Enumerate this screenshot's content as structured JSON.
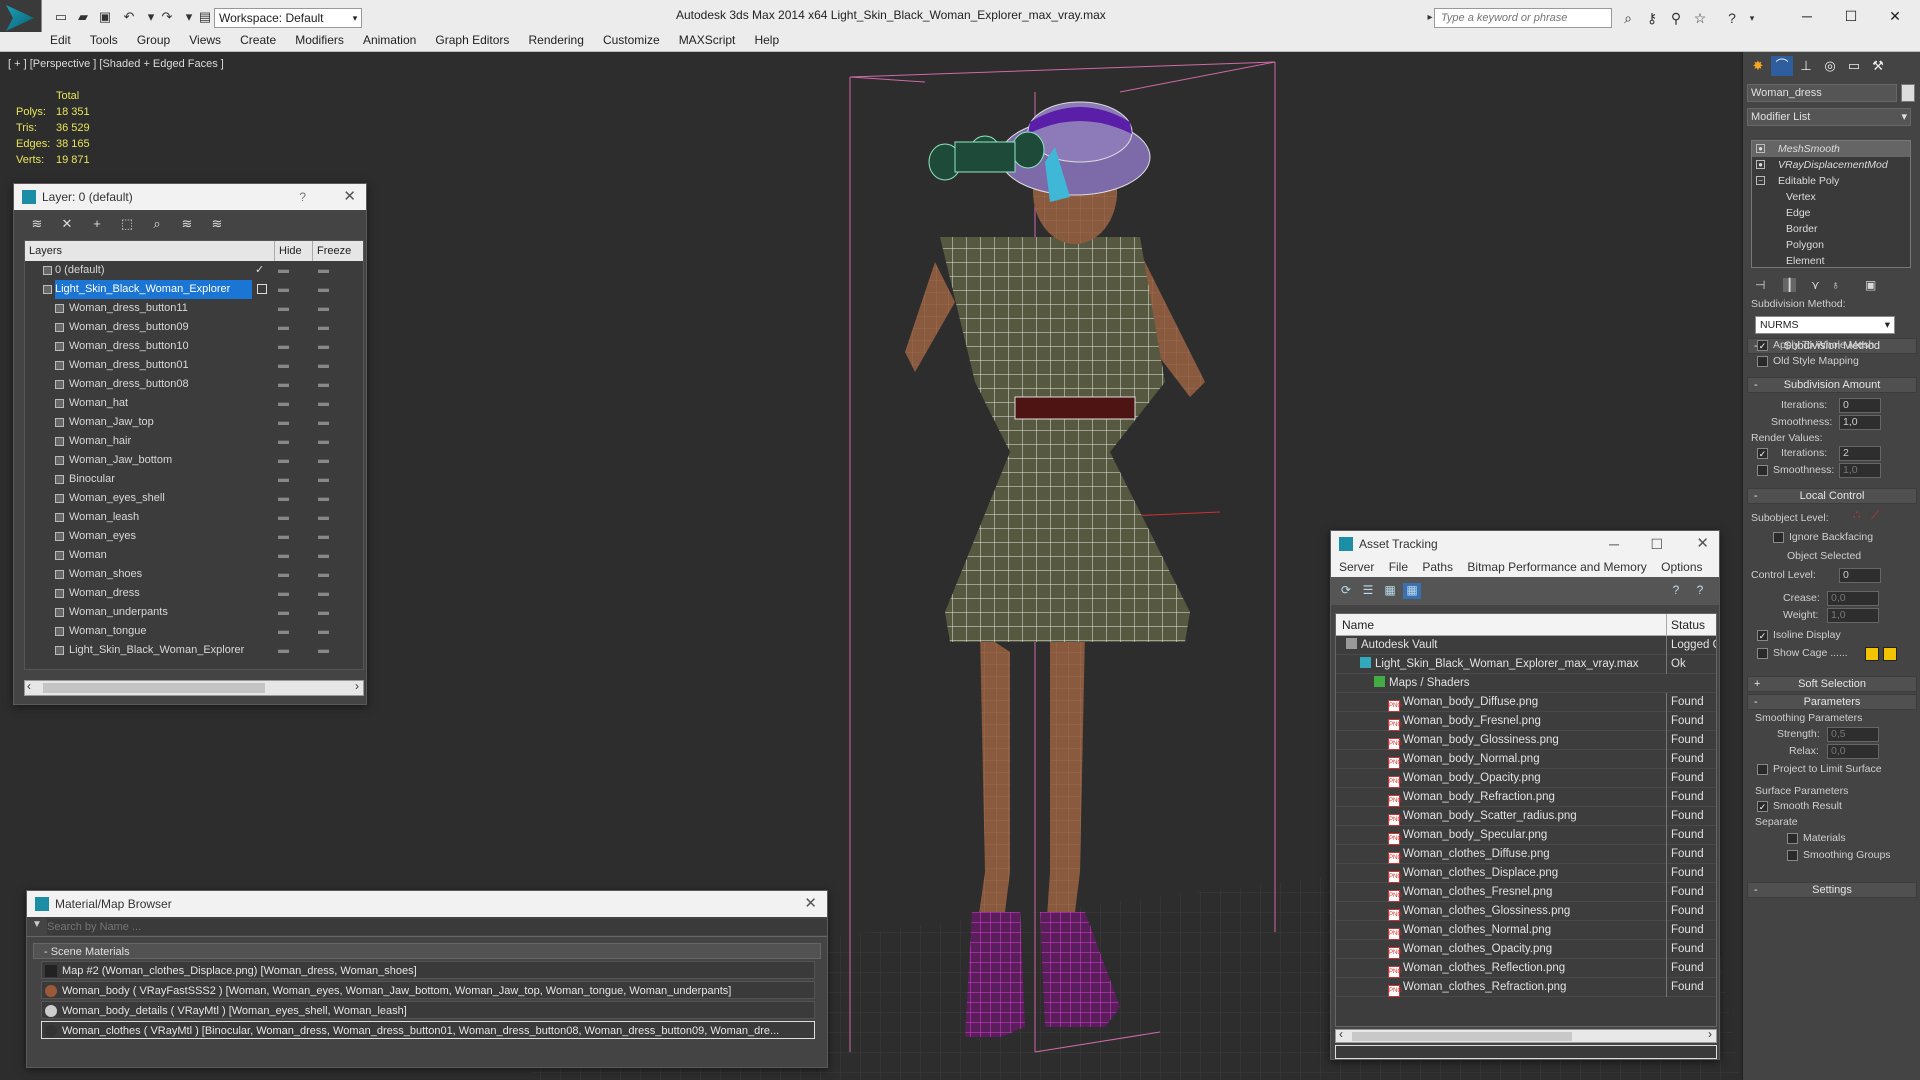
{
  "titlebar": {
    "workspace": "Workspace: Default",
    "app_title": "Autodesk 3ds Max  2014 x64      Light_Skin_Black_Woman_Explorer_max_vray.max",
    "search_placeholder": "Type a keyword or phrase"
  },
  "menu": [
    "Edit",
    "Tools",
    "Group",
    "Views",
    "Create",
    "Modifiers",
    "Animation",
    "Graph Editors",
    "Rendering",
    "Customize",
    "MAXScript",
    "Help"
  ],
  "viewport": {
    "label": "[ + ] [Perspective ] [Shaded + Edged Faces ]",
    "stats_header": "Total",
    "stats": [
      {
        "k": "Polys:",
        "v": "18 351"
      },
      {
        "k": "Tris:",
        "v": "36 529"
      },
      {
        "k": "Edges:",
        "v": "38 165"
      },
      {
        "k": "Verts:",
        "v": "19 871"
      }
    ]
  },
  "layer_panel": {
    "title": "Layer: 0 (default)",
    "help": "?",
    "col_layers": "Layers",
    "col_hide": "Hide",
    "col_freeze": "Freeze",
    "check_mark": "✓",
    "rows": [
      {
        "name": "0 (default)",
        "indent": 1
      },
      {
        "name": "Light_Skin_Black_Woman_Explorer",
        "indent": 1,
        "selected": true
      },
      {
        "name": "Woman_dress_button11",
        "indent": 2
      },
      {
        "name": "Woman_dress_button09",
        "indent": 2
      },
      {
        "name": "Woman_dress_button10",
        "indent": 2
      },
      {
        "name": "Woman_dress_button01",
        "indent": 2
      },
      {
        "name": "Woman_dress_button08",
        "indent": 2
      },
      {
        "name": "Woman_hat",
        "indent": 2
      },
      {
        "name": "Woman_Jaw_top",
        "indent": 2
      },
      {
        "name": "Woman_hair",
        "indent": 2
      },
      {
        "name": "Woman_Jaw_bottom",
        "indent": 2
      },
      {
        "name": "Binocular",
        "indent": 2
      },
      {
        "name": "Woman_eyes_shell",
        "indent": 2
      },
      {
        "name": "Woman_leash",
        "indent": 2
      },
      {
        "name": "Woman_eyes",
        "indent": 2
      },
      {
        "name": "Woman",
        "indent": 2
      },
      {
        "name": "Woman_shoes",
        "indent": 2
      },
      {
        "name": "Woman_dress",
        "indent": 2
      },
      {
        "name": "Woman_underpants",
        "indent": 2
      },
      {
        "name": "Woman_tongue",
        "indent": 2
      },
      {
        "name": "Light_Skin_Black_Woman_Explorer",
        "indent": 2
      }
    ]
  },
  "material_browser": {
    "title": "Material/Map Browser",
    "search_placeholder": "Search by Name ...",
    "section": "- Scene Materials",
    "rows": [
      "Map #2 (Woman_clothes_Displace.png) [Woman_dress, Woman_shoes]",
      "Woman_body  ( VRayFastSSS2 ) [Woman, Woman_eyes, Woman_Jaw_bottom, Woman_Jaw_top, Woman_tongue, Woman_underpants]",
      "Woman_body_details  ( VRayMtl ) [Woman_eyes_shell, Woman_leash]",
      "Woman_clothes  ( VRayMtl ) [Binocular, Woman_dress, Woman_dress_button01, Woman_dress_button08, Woman_dress_button09, Woman_dre..."
    ]
  },
  "asset_tracking": {
    "title": "Asset Tracking",
    "menu": [
      "Server",
      "File",
      "Paths",
      "Bitmap Performance and Memory",
      "Options"
    ],
    "col_name": "Name",
    "col_status": "Status",
    "png_tag": "PNG",
    "rows": [
      {
        "name": "Autodesk Vault",
        "status": "Logged O",
        "indent": 0
      },
      {
        "name": "Light_Skin_Black_Woman_Explorer_max_vray.max",
        "status": "Ok",
        "indent": 1
      },
      {
        "name": "Maps / Shaders",
        "status": "",
        "indent": 2
      },
      {
        "name": "Woman_body_Diffuse.png",
        "status": "Found",
        "indent": 3
      },
      {
        "name": "Woman_body_Fresnel.png",
        "status": "Found",
        "indent": 3
      },
      {
        "name": "Woman_body_Glossiness.png",
        "status": "Found",
        "indent": 3
      },
      {
        "name": "Woman_body_Normal.png",
        "status": "Found",
        "indent": 3
      },
      {
        "name": "Woman_body_Opacity.png",
        "status": "Found",
        "indent": 3
      },
      {
        "name": "Woman_body_Refraction.png",
        "status": "Found",
        "indent": 3
      },
      {
        "name": "Woman_body_Scatter_radius.png",
        "status": "Found",
        "indent": 3
      },
      {
        "name": "Woman_body_Specular.png",
        "status": "Found",
        "indent": 3
      },
      {
        "name": "Woman_clothes_Diffuse.png",
        "status": "Found",
        "indent": 3
      },
      {
        "name": "Woman_clothes_Displace.png",
        "status": "Found",
        "indent": 3
      },
      {
        "name": "Woman_clothes_Fresnel.png",
        "status": "Found",
        "indent": 3
      },
      {
        "name": "Woman_clothes_Glossiness.png",
        "status": "Found",
        "indent": 3
      },
      {
        "name": "Woman_clothes_Normal.png",
        "status": "Found",
        "indent": 3
      },
      {
        "name": "Woman_clothes_Opacity.png",
        "status": "Found",
        "indent": 3
      },
      {
        "name": "Woman_clothes_Reflection.png",
        "status": "Found",
        "indent": 3
      },
      {
        "name": "Woman_clothes_Refraction.png",
        "status": "Found",
        "indent": 3
      }
    ]
  },
  "command_panel": {
    "object_name": "Woman_dress",
    "modifier_list": "Modifier List",
    "stack": [
      {
        "name": "MeshSmooth",
        "italic": true,
        "selected": true
      },
      {
        "name": "VRayDisplacementMod",
        "italic": true
      },
      {
        "name": "Editable Poly"
      },
      {
        "name": "Vertex",
        "sub": true
      },
      {
        "name": "Edge",
        "sub": true
      },
      {
        "name": "Border",
        "sub": true
      },
      {
        "name": "Polygon",
        "sub": true
      },
      {
        "name": "Element",
        "sub": true
      }
    ],
    "subdivision_method_title": "Subdivision Method",
    "subdivision_method_label": "Subdivision Method:",
    "subdivision_method_value": "NURMS",
    "apply_whole_mesh": "Apply To Whole Mesh",
    "old_style_mapping": "Old Style Mapping",
    "subdivision_amount_title": "Subdivision Amount",
    "iterations_label": "Iterations:",
    "iterations_value": "0",
    "smoothness_label": "Smoothness:",
    "smoothness_value": "1,0",
    "render_values": "Render Values:",
    "r_iterations_value": "2",
    "r_smoothness_value": "1,0",
    "local_control_title": "Local Control",
    "subobject_level": "Subobject Level:",
    "ignore_backfacing": "Ignore Backfacing",
    "object_selected": "Object Selected",
    "control_level": "Control Level:",
    "control_level_value": "0",
    "crease_label": "Crease:",
    "crease_value": "0,0",
    "weight_label": "Weight:",
    "weight_value": "1,0",
    "isoline_display": "Isoline Display",
    "show_cage": "Show Cage ......",
    "soft_selection_title": "Soft Selection",
    "parameters_title": "Parameters",
    "smoothing_parameters": "Smoothing Parameters",
    "strength_label": "Strength:",
    "strength_value": "0,5",
    "relax_label": "Relax:",
    "relax_value": "0,0",
    "project_limit": "Project to Limit Surface",
    "surface_parameters": "Surface Parameters",
    "smooth_result": "Smooth Result",
    "separate": "Separate",
    "materials": "Materials",
    "smoothing_groups": "Smoothing Groups",
    "settings_title": "Settings",
    "rollout_minus": "-",
    "rollout_plus": "+",
    "cage_color": "#f2c400"
  },
  "icons": {
    "close": "✕",
    "minimize": "─",
    "maximize": "☐",
    "help": "?",
    "dropdown": "▾",
    "scroll_left": "‹",
    "scroll_right": "›"
  }
}
